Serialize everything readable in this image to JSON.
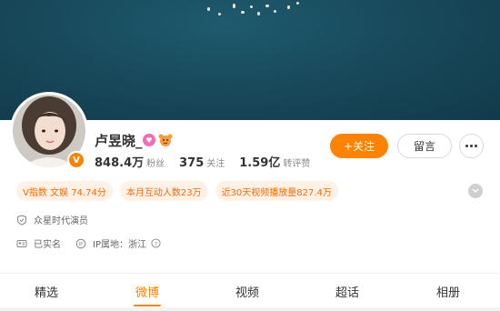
{
  "profile": {
    "name": "卢昱晓_",
    "verified_badge": "V",
    "avatar_icon": "avatar",
    "accent": "#ff8200"
  },
  "stats": [
    {
      "value": "848.4万",
      "label": "粉丝"
    },
    {
      "value": "375",
      "label": "关注"
    },
    {
      "value": "1.59亿",
      "label": "转评赞"
    }
  ],
  "actions": {
    "follow_label": "+关注",
    "message_label": "留言"
  },
  "tags": [
    "V指数 文娱 74.74分",
    "本月互动人数23万",
    "近30天视频播放量827.4万"
  ],
  "info": {
    "company": "众星时代演员",
    "realname": "已实名",
    "ip_location": "IP属地：浙江"
  },
  "tabs": [
    {
      "label": "精选"
    },
    {
      "label": "微博"
    },
    {
      "label": "视频"
    },
    {
      "label": "超话"
    },
    {
      "label": "相册"
    }
  ],
  "active_tab": "微博"
}
